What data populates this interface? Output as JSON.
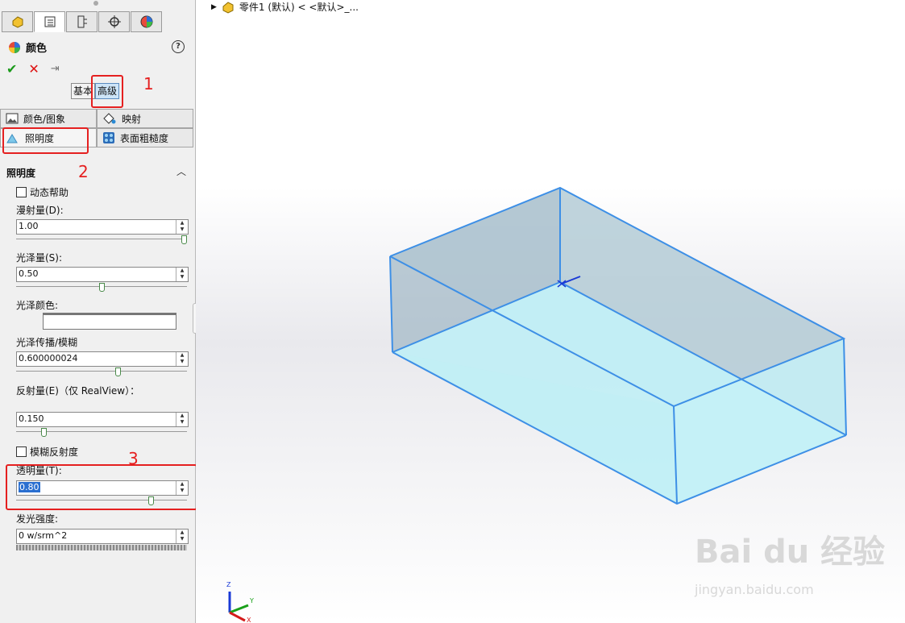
{
  "panel": {
    "title": "颜色",
    "help": "?",
    "ok": "✔",
    "cancel": "✕",
    "pin": "⇥",
    "mode_basic": "基本",
    "mode_advanced": "高级",
    "subtabs": [
      "颜色/图象",
      "映射",
      "照明度",
      "表面粗糙度"
    ],
    "section_title": "照明度",
    "dynamic_help": "动态帮助",
    "fields": {
      "diffuse": {
        "label": "漫射量(D):",
        "value": "1.00",
        "level": 1.0
      },
      "specular": {
        "label": "光泽量(S):",
        "value": "0.50",
        "level": 0.5
      },
      "specular_color": {
        "label": "光泽颜色:"
      },
      "spread": {
        "label": "光泽传播/模糊",
        "value": "0.600000024",
        "level": 0.6
      },
      "reflection": {
        "label": "反射量(E)（仅 RealView）：",
        "value": "0.150",
        "level": 0.15
      },
      "blurry_reflection": "模糊反射度",
      "transparency": {
        "label": "透明量(T):",
        "value": "0.80",
        "level": 0.8
      },
      "luminous": {
        "label": "发光强度:",
        "value": "0 w/srm^2"
      }
    },
    "annotations": [
      "1",
      "2",
      "3"
    ]
  },
  "viewport": {
    "tree_item": "零件1 (默认) < <默认>_..."
  },
  "triad": {
    "z": "Z",
    "y": "Y",
    "x": "X"
  },
  "watermark": {
    "brand": "Bai du 经验",
    "url": "jingyan.baidu.com"
  },
  "colors": {
    "accent_red": "#e52020",
    "box_edge": "#3d8fe6",
    "box_face": "#bfeff5"
  }
}
